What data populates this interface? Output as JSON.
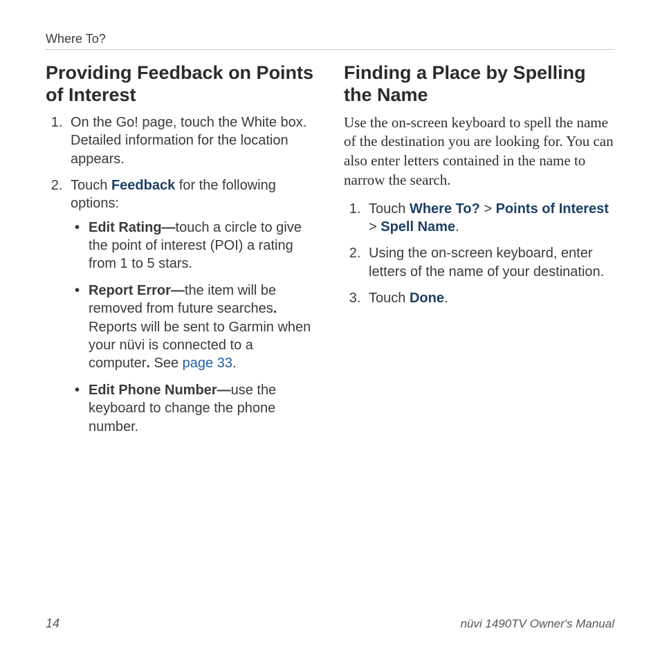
{
  "running_head": "Where To?",
  "left": {
    "heading": "Providing Feedback on Points of Interest",
    "step1_pre": "On the ",
    "step1_mid": "Go! page, touch the White",
    "step1_post": " box. Detailed information for the location appears.",
    "step2_pre": "Touch ",
    "step2_feedback": "Feedback",
    "step2_post": " for the following options:",
    "bullets": {
      "b1_label": "Edit Rating—",
      "b1_text": "touch a circle to give the point of interest (POI) a rating from 1 to 5 stars.",
      "b2_label": "Report Error—",
      "b2_text1": "the item will be removed from future searches",
      "b2_dot1": ".",
      "b2_text2": " Reports will be sent to Garmin when your nüvi is connected to a computer",
      "b2_dot2": ".",
      "b2_see_pre": " See ",
      "b2_see_link": "page 33",
      "b2_see_post": ".",
      "b3_label": "Edit Phone Number—",
      "b3_text": "use the keyboard to change the phone number."
    }
  },
  "right": {
    "heading": "Finding a Place by Spelling the Name",
    "intro": "Use the on-screen keyboard to spell the name of the destination you are looking for. You can also enter letters contained in the name to narrow the search.",
    "s1_pre": "Touch ",
    "s1_a": "Where To?",
    "s1_gt1": " > ",
    "s1_b": "Points of Interest",
    "s1_gt2": " > ",
    "s1_c": "Spell Name",
    "s1_post": ".",
    "s2_text": "Using the on-screen keyboard, enter letters of the name of your destination.",
    "s3_pre": "Touch ",
    "s3_done": "Done",
    "s3_post": "."
  },
  "footer": {
    "page_number": "14",
    "doc_title": "nüvi 1490TV Owner's Manual"
  }
}
